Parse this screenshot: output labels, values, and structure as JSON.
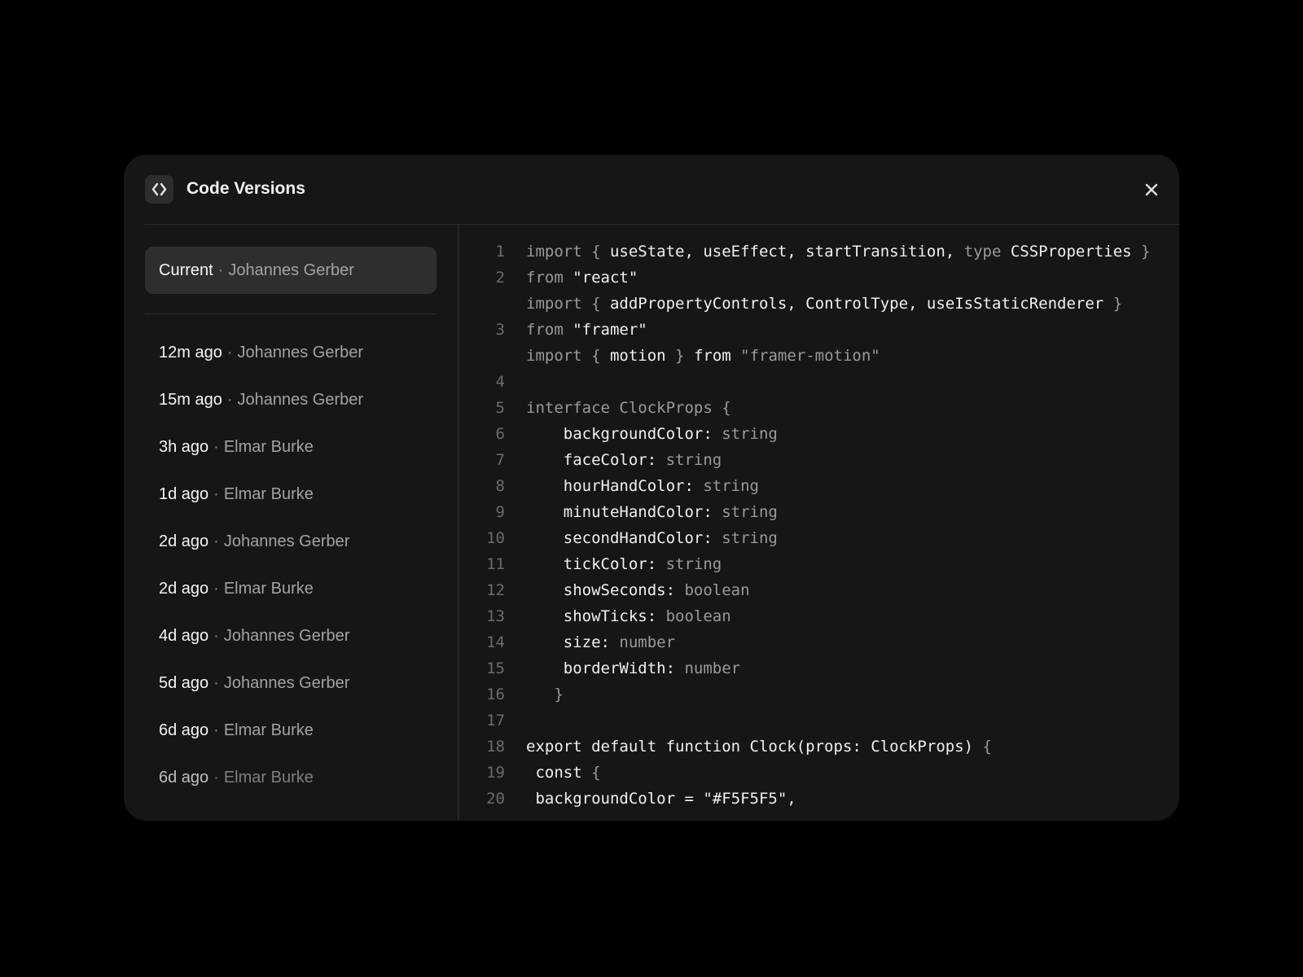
{
  "dialog": {
    "title": "Code Versions",
    "icon": "code-icon",
    "close_icon": "close-icon"
  },
  "sidebar": {
    "current": {
      "time": "Current",
      "author": "Johannes Gerber"
    },
    "versions": [
      {
        "time": "12m ago",
        "author": "Johannes Gerber"
      },
      {
        "time": "15m ago",
        "author": "Johannes Gerber"
      },
      {
        "time": "3h ago",
        "author": "Elmar Burke"
      },
      {
        "time": "1d ago",
        "author": "Elmar Burke"
      },
      {
        "time": "2d ago",
        "author": "Johannes Gerber"
      },
      {
        "time": "2d ago",
        "author": "Elmar Burke"
      },
      {
        "time": "4d ago",
        "author": "Johannes Gerber"
      },
      {
        "time": "5d ago",
        "author": "Johannes Gerber"
      },
      {
        "time": "6d ago",
        "author": "Elmar Burke"
      },
      {
        "time": "6d ago",
        "author": "Elmar Burke"
      }
    ]
  },
  "code": {
    "lines": [
      {
        "n": "1",
        "segments": [
          [
            "import ",
            "dim"
          ],
          [
            "{ ",
            "dim"
          ],
          [
            "useState, useEffect, startTransition, ",
            ""
          ],
          [
            "type ",
            "dim"
          ],
          [
            "CSSProperties ",
            ""
          ],
          [
            "}",
            "dim"
          ]
        ]
      },
      {
        "n": "2",
        "segments": [
          [
            "from ",
            "dim"
          ],
          [
            "\"react\"",
            ""
          ]
        ]
      },
      {
        "n": "",
        "segments": [
          [
            "import ",
            "dim"
          ],
          [
            "{ ",
            "dim"
          ],
          [
            "addPropertyControls, ControlType, useIsStaticRenderer ",
            ""
          ],
          [
            "}",
            "dim"
          ]
        ]
      },
      {
        "n": "3",
        "segments": [
          [
            "from ",
            "dim"
          ],
          [
            "\"framer\"",
            ""
          ]
        ]
      },
      {
        "n": "",
        "segments": [
          [
            "import ",
            "dim"
          ],
          [
            "{ ",
            "dim"
          ],
          [
            "motion ",
            ""
          ],
          [
            "} ",
            "dim"
          ],
          [
            "from ",
            ""
          ],
          [
            "\"framer-motion\"",
            "dim"
          ]
        ]
      },
      {
        "n": "4",
        "segments": []
      },
      {
        "n": "5",
        "segments": [
          [
            "interface ClockProps {",
            "dim"
          ]
        ]
      },
      {
        "n": "6",
        "segments": [
          [
            "    backgroundColor: ",
            ""
          ],
          [
            "string",
            "dim"
          ]
        ]
      },
      {
        "n": "7",
        "segments": [
          [
            "    faceColor: ",
            ""
          ],
          [
            "string",
            "dim"
          ]
        ]
      },
      {
        "n": "8",
        "segments": [
          [
            "    hourHandColor: ",
            ""
          ],
          [
            "string",
            "dim"
          ]
        ]
      },
      {
        "n": "9",
        "segments": [
          [
            "    minuteHandColor: ",
            ""
          ],
          [
            "string",
            "dim"
          ]
        ]
      },
      {
        "n": "10",
        "segments": [
          [
            "    secondHandColor: ",
            ""
          ],
          [
            "string",
            "dim"
          ]
        ]
      },
      {
        "n": "11",
        "segments": [
          [
            "    tickColor: ",
            ""
          ],
          [
            "string",
            "dim"
          ]
        ]
      },
      {
        "n": "12",
        "segments": [
          [
            "    showSeconds: ",
            ""
          ],
          [
            "boolean",
            "dim"
          ]
        ]
      },
      {
        "n": "13",
        "segments": [
          [
            "    showTicks: ",
            ""
          ],
          [
            "boolean",
            "dim"
          ]
        ]
      },
      {
        "n": "14",
        "segments": [
          [
            "    size: ",
            ""
          ],
          [
            "number",
            "dim"
          ]
        ]
      },
      {
        "n": "15",
        "segments": [
          [
            "    borderWidth: ",
            ""
          ],
          [
            "number",
            "dim"
          ]
        ]
      },
      {
        "n": "16",
        "segments": [
          [
            "   }",
            "dim"
          ]
        ]
      },
      {
        "n": "17",
        "segments": []
      },
      {
        "n": "18",
        "segments": [
          [
            "export default function Clock(props: ClockProps) ",
            ""
          ],
          [
            "{",
            "dim"
          ]
        ]
      },
      {
        "n": "19",
        "segments": [
          [
            " const ",
            ""
          ],
          [
            "{",
            "dim"
          ]
        ]
      },
      {
        "n": "20",
        "segments": [
          [
            " backgroundColor = \"#F5F5F5\",",
            ""
          ]
        ]
      }
    ]
  }
}
